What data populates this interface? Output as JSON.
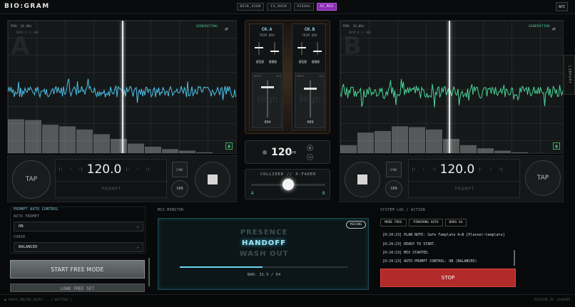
{
  "app": {
    "logo": "BIO:GRAM",
    "api": "API"
  },
  "nav": [
    {
      "label": "DECK_VIEW"
    },
    {
      "label": "FX_RACK"
    },
    {
      "label": "VISUAL"
    },
    {
      "label": "AI_MIX"
    }
  ],
  "deckA": {
    "letter": "A",
    "min": "MIN: 16.00s",
    "sub": "DECK_A // 002",
    "status": "GENERATING",
    "wave_color": "#4cc3ea",
    "bars": [
      0.45,
      0.44,
      0.38,
      0.36,
      0.32,
      0.26,
      0.2,
      0.14,
      0.1,
      0.07,
      0.05,
      0.03
    ],
    "tempo": "120.0",
    "prompt": "PROMPT",
    "tap": "TAP",
    "sync": "SYNC",
    "gen": "GEN"
  },
  "deckB": {
    "letter": "B",
    "min": "MIN: 16.00s",
    "sub": "DECK_B // 002",
    "status": "GENERATING",
    "wave_color": "#49d49a",
    "bars": [
      0.12,
      0.28,
      0.3,
      0.36,
      0.35,
      0.32,
      0.2,
      0.12,
      0.08,
      0.05,
      0.03,
      0.02
    ],
    "tempo": "120.0",
    "prompt": "PROMPT",
    "tap": "TAP",
    "sync": "SYNC",
    "gen": "GEN"
  },
  "mixer": {
    "chA": {
      "name": "CH.A",
      "trim": "TRIM DRV",
      "k1": "050",
      "k2": "000",
      "fad_l": "RESET",
      "fad_r": "ALL",
      "ghost": "High",
      "value": "094",
      "level": 0.85
    },
    "chB": {
      "name": "CH.B",
      "trim": "TRIM DRV",
      "k1": "050",
      "k2": "000",
      "fad_l": "RESET",
      "fad_r": "ALL",
      "ghost": "High",
      "value": "089",
      "level": 0.8
    },
    "bpm": "120",
    "bpm_unit": "BPM",
    "plus": "+",
    "minus": "−",
    "xfader_title": "COLLIDER // X-FADER",
    "xfader_a": "A",
    "xfader_b": "B",
    "xfader_pos": 0.5
  },
  "library": "LIBRARY",
  "prompt_control": {
    "title": "PROMPT AUTO CONTROL",
    "auto_label": "AUTO PROMPT",
    "auto_value": "ON",
    "curve_label": "CURVE",
    "curve_value": "BALANCED",
    "free_button": "START FREE MODE",
    "hidden_button": "LOAD FREE SET"
  },
  "mix_monitor": {
    "title": "MIX MONITOR",
    "badge": "MIXING",
    "phases": [
      "PRESENCE",
      "HANDOFF",
      "WASH OUT"
    ],
    "progress": 0.49,
    "bars": "BAR: 31.5 / 64"
  },
  "syslog": {
    "title": "SYSTEM LOG / ACTION",
    "tags": [
      "MODE FREE",
      "PINGPONG AUTO",
      "BARS 64"
    ],
    "lines": [
      "[0:24:23] PLAN NOTE: Safe Template A→B [Planner:template]",
      "[0:24:23] READY TO START.",
      "[0:24:23] MIX STARTED.",
      "[0:24:23] AUTO PROMPT CONTROL: ON (BALANCED)"
    ],
    "stop": "STOP"
  },
  "status": {
    "left": "● AUDIO_ENGINE_READY...  [ WAITING ]",
    "right": "SESSION_ID: 0x0A0DF"
  }
}
